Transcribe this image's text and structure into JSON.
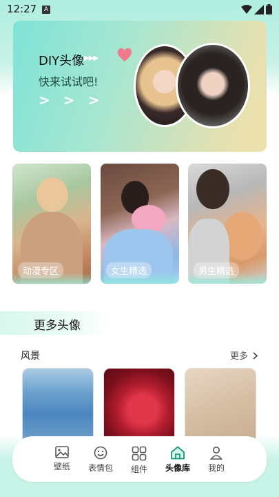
{
  "status_bar": {
    "time": "12:27",
    "notification_icon": "A"
  },
  "banner": {
    "title": "DIY头像",
    "arrows_small": "▶▶▶",
    "subtitle": "快来试试吧!",
    "chevrons": "> > >"
  },
  "categories": [
    {
      "label": "动漫专区"
    },
    {
      "label": "女生精选"
    },
    {
      "label": "男生精选"
    }
  ],
  "more_section": {
    "title": "更多头像"
  },
  "scenery": {
    "label": "风景",
    "more_label": "更多"
  },
  "nav": [
    {
      "label": "壁纸",
      "icon": "image-icon"
    },
    {
      "label": "表情包",
      "icon": "emoji-icon"
    },
    {
      "label": "组件",
      "icon": "widget-icon"
    },
    {
      "label": "头像库",
      "icon": "home-icon",
      "active": true
    },
    {
      "label": "我的",
      "icon": "person-icon"
    }
  ],
  "colors": {
    "accent": "#0f9a7a",
    "banner_start": "#7fe3d7",
    "banner_end": "#efe0ab"
  }
}
